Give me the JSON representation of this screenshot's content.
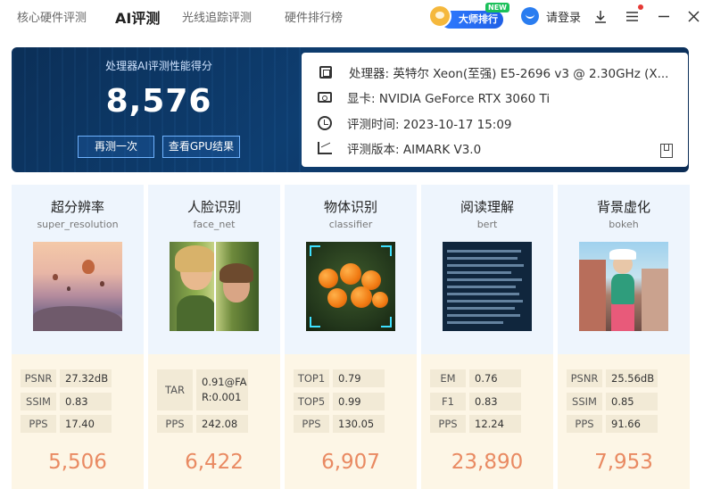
{
  "nav": {
    "tabs": [
      {
        "label": "核心硬件评测",
        "active": false
      },
      {
        "label": "AI评测",
        "active": true
      },
      {
        "label": "光线追踪评测",
        "active": false
      },
      {
        "label": "硬件排行榜",
        "active": false
      }
    ],
    "master_rank_label": "大师排行",
    "new_tag": "NEW",
    "login_label": "请登录"
  },
  "summary": {
    "score_title": "处理器AI评测性能得分",
    "score_value": "8,576",
    "retest_button": "再测一次",
    "gpu_result_button": "查看GPU结果",
    "info": {
      "cpu_label": "处理器:",
      "cpu_value": "英特尔 Xeon(至强) E5-2696 v3 @ 2.30GHz (X...",
      "gpu_label": "显卡:",
      "gpu_value": "NVIDIA GeForce RTX 3060 Ti",
      "time_label": "评测时间:",
      "time_value": "2023-10-17 15:09",
      "version_label": "评测版本:",
      "version_value": "AIMARK V3.0"
    }
  },
  "tests": [
    {
      "title": "超分辨率",
      "subtitle": "super_resolution",
      "metrics": [
        [
          "PSNR",
          "27.32dB"
        ],
        [
          "SSIM",
          "0.83"
        ],
        [
          "PPS",
          "17.40"
        ]
      ],
      "score": "5,506"
    },
    {
      "title": "人脸识别",
      "subtitle": "face_net",
      "metrics": [
        [
          "TAR",
          "0.91@FAR:0.001"
        ],
        [
          "PPS",
          "242.08"
        ]
      ],
      "score": "6,422"
    },
    {
      "title": "物体识别",
      "subtitle": "classifier",
      "metrics": [
        [
          "TOP1",
          "0.79"
        ],
        [
          "TOP5",
          "0.99"
        ],
        [
          "PPS",
          "130.05"
        ]
      ],
      "score": "6,907"
    },
    {
      "title": "阅读理解",
      "subtitle": "bert",
      "metrics": [
        [
          "EM",
          "0.76"
        ],
        [
          "F1",
          "0.83"
        ],
        [
          "PPS",
          "12.24"
        ]
      ],
      "score": "23,890"
    },
    {
      "title": "背景虚化",
      "subtitle": "bokeh",
      "metrics": [
        [
          "PSNR",
          "25.56dB"
        ],
        [
          "SSIM",
          "0.85"
        ],
        [
          "PPS",
          "91.66"
        ]
      ],
      "score": "7,953"
    }
  ],
  "colors": {
    "accent": "#2f7bff",
    "banner": "#0e3e71",
    "score_orange": "#e98a62",
    "new_green": "#1bc05a"
  }
}
